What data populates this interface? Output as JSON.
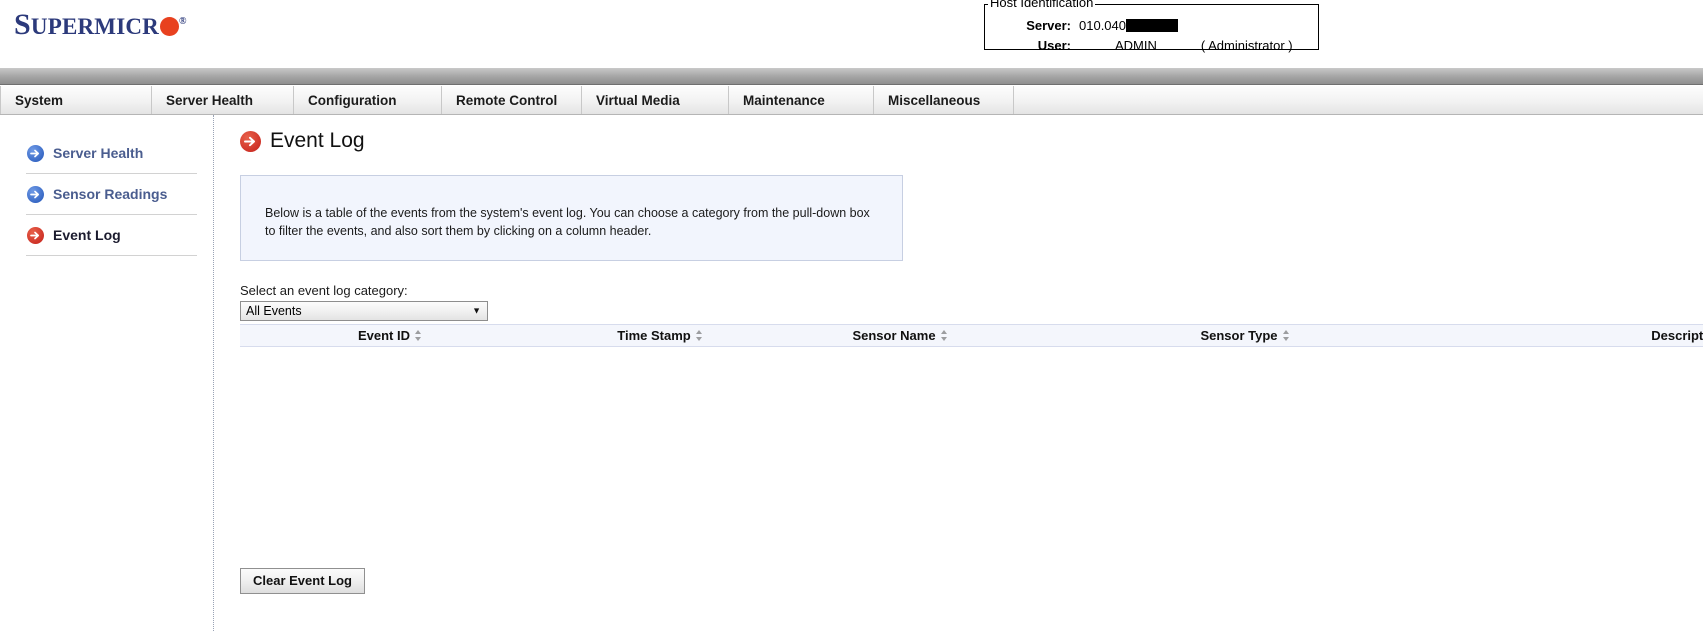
{
  "brand": {
    "name_cap": "S",
    "name_rest": "UPERMICR",
    "registered": "®"
  },
  "host_identification": {
    "legend": "Host Identification",
    "server_label": "Server:",
    "server_value": "010.040",
    "server_redacted": true,
    "user_label": "User:",
    "user_value": "ADMIN",
    "user_role": "( Administrator )"
  },
  "nav": {
    "items": [
      {
        "label": "System"
      },
      {
        "label": "Server Health"
      },
      {
        "label": "Configuration"
      },
      {
        "label": "Remote Control"
      },
      {
        "label": "Virtual Media"
      },
      {
        "label": "Maintenance"
      },
      {
        "label": "Miscellaneous"
      }
    ]
  },
  "sidebar": {
    "items": [
      {
        "label": "Server Health",
        "icon": "arrow-circle-icon",
        "color": "#2255b8",
        "active": false
      },
      {
        "label": "Sensor Readings",
        "icon": "arrow-circle-icon",
        "color": "#2255b8",
        "active": false
      },
      {
        "label": "Event Log",
        "icon": "arrow-circle-icon",
        "color": "#c4201a",
        "active": true
      }
    ]
  },
  "main": {
    "title": "Event Log",
    "title_icon": "arrow-circle-icon",
    "info_text": "Below is a table of the events from the system's event log. You can choose a category from the pull-down box to filter the events, and also sort them by clicking on a column header.",
    "select_label": "Select an event log category:",
    "select_value": "All Events",
    "select_options": [
      "All Events"
    ],
    "select_arrow_icon": "chevron-down-icon",
    "table": {
      "columns": [
        {
          "label": "Event ID",
          "sortable": true
        },
        {
          "label": "Time Stamp",
          "sortable": true
        },
        {
          "label": "Sensor Name",
          "sortable": true
        },
        {
          "label": "Sensor Type",
          "sortable": true
        },
        {
          "label": "Description",
          "sortable": true
        }
      ],
      "rows": []
    },
    "clear_button": "Clear Event Log"
  },
  "colors": {
    "brand_blue": "#2c3a7b",
    "brand_red": "#e8411f",
    "link_blue": "#4a5d8f",
    "info_bg": "#f2f5fd",
    "table_header_bg": "#f4f6fc"
  }
}
